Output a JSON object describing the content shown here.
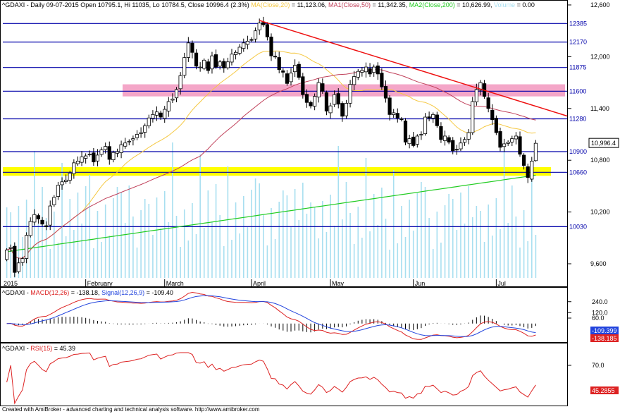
{
  "header": {
    "symbol_line": "^GDAXI - Daily 09-07-2015 Open 10795.1, Hi 11035, Lo 10784.5, Close 10996.4 (2.3%)",
    "ma_label": "MA(Close,20)",
    "ma_value": " = 11,123.06,",
    "ma1_label": "MA1(Close,50)",
    "ma1_value": " = 11,342.35,",
    "ma2_label": "MA2(Close,200)",
    "ma2_value": " = 10,626.99,",
    "vol_label": "Volume",
    "vol_value": " = 0.00"
  },
  "macd_header": {
    "prefix": "^GDAXI - ",
    "macd_label": "MACD(12,26)",
    "macd_value": " = -138.18, ",
    "signal_label": "Signal(12,26,9)",
    "signal_value": " = -109.40"
  },
  "rsi_header": {
    "prefix": "^GDAXI - ",
    "rsi_label": "RSI(15)",
    "rsi_value": " = 45.39"
  },
  "footer_text": "Created with AmiBroker - advanced charting and technical analysis software. http://www.amibroker.com",
  "colors": {
    "candle_up": "#ffffff",
    "candle_down": "#000000",
    "ma20": "#f5c842",
    "ma50": "#c0405a",
    "ma200": "#22cc22",
    "volume": "#a8dff0",
    "levels": "#0000aa",
    "trendline": "#ee1111",
    "resistance_zone": "#f4a6c8",
    "support_zone": "#ffff00",
    "macd": "#dd2222",
    "signal": "#2244dd",
    "rsi": "#dd2222"
  },
  "chart_data": [
    {
      "type": "candlestick",
      "title": "^GDAXI - Daily",
      "ylim": [
        9400,
        12600
      ],
      "y_ticks": [
        9600,
        10200,
        10800,
        11400,
        12000,
        12600
      ],
      "x_months": [
        "2015",
        "February",
        "March",
        "April",
        "May",
        "Jun",
        "Jul"
      ],
      "level_lines": [
        12385,
        12170,
        11875,
        11600,
        11280,
        10900,
        10660,
        10030
      ],
      "last_close_label": "10,996.4",
      "resistance_zone": [
        11540,
        11680
      ],
      "support_zone": [
        10620,
        10720
      ],
      "trendline": {
        "start": {
          "bar": 135,
          "value": 12420
        },
        "end": {
          "bar": 135,
          "value": 12420
        }
      },
      "ohlc": []
    },
    {
      "type": "line",
      "title": "MACD",
      "y_ticks": [
        240.0,
        120.0,
        60.0
      ],
      "series": [
        {
          "name": "MACD(12,26)",
          "last_value": "-138.185"
        },
        {
          "name": "Signal(12,26,9)",
          "last_value": "-109.399"
        }
      ]
    },
    {
      "type": "line",
      "title": "RSI",
      "y_ticks": [
        70.0
      ],
      "series": [
        {
          "name": "RSI(15)",
          "last_value": "45.2855"
        }
      ]
    }
  ]
}
